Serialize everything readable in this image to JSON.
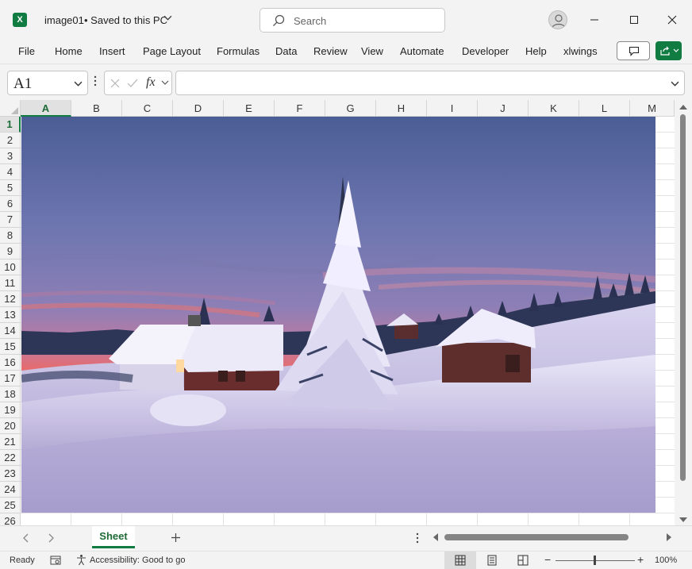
{
  "window": {
    "doc_name": "image01",
    "doc_status": "• Saved to this PC",
    "search_placeholder": "Search"
  },
  "menu": [
    "File",
    "Home",
    "Insert",
    "Page Layout",
    "Formulas",
    "Data",
    "Review",
    "View",
    "Automate",
    "Developer",
    "Help",
    "xlwings"
  ],
  "formula_bar": {
    "name_box": "A1",
    "fx": "fx",
    "formula": ""
  },
  "grid": {
    "columns": [
      "A",
      "B",
      "C",
      "D",
      "E",
      "F",
      "G",
      "H",
      "I",
      "J",
      "K",
      "L",
      "M"
    ],
    "rows": [
      "1",
      "2",
      "3",
      "4",
      "5",
      "6",
      "7",
      "8",
      "9",
      "10",
      "11",
      "12",
      "13",
      "14",
      "15",
      "16",
      "17",
      "18",
      "19",
      "20",
      "21",
      "22",
      "23",
      "24",
      "25",
      "26"
    ],
    "selected_col": "A",
    "selected_row": "1"
  },
  "sheets": {
    "active": "Sheet"
  },
  "status": {
    "ready": "Ready",
    "accessibility": "Accessibility: Good to go",
    "zoom": "100%"
  },
  "colors": {
    "accent": "#107c41",
    "sky_top": "#4a5c93",
    "horizon": "#ff6a4a",
    "snow": "#d8d3ec"
  }
}
